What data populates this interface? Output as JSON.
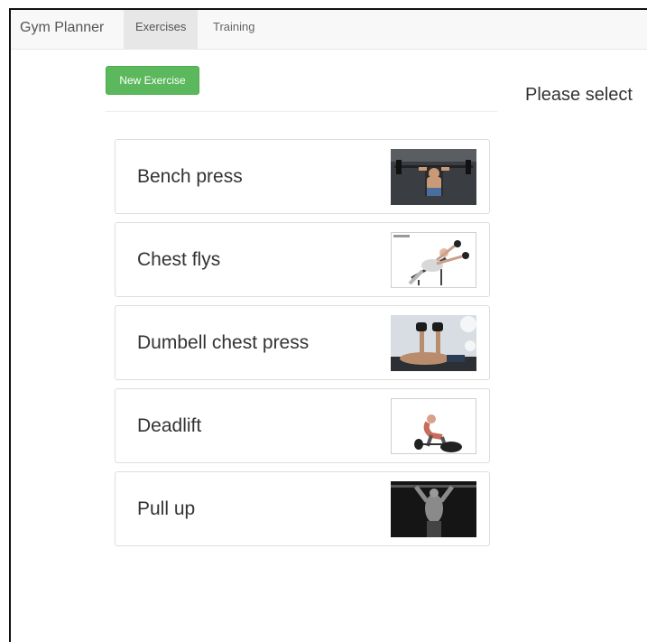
{
  "navbar": {
    "brand": "Gym Planner",
    "tabs": [
      {
        "label": "Exercises",
        "active": true
      },
      {
        "label": "Training",
        "active": false
      }
    ]
  },
  "actions": {
    "new_exercise_label": "New Exercise",
    "button_color": "#5cb85c"
  },
  "detail_panel": {
    "message": "Please select"
  },
  "exercises": [
    {
      "name": "Bench press",
      "thumbnail": "bench-press-photo"
    },
    {
      "name": "Chest flys",
      "thumbnail": "chest-flys-diagram"
    },
    {
      "name": "Dumbell chest press",
      "thumbnail": "dumbell-chest-press-photo"
    },
    {
      "name": "Deadlift",
      "thumbnail": "deadlift-diagram"
    },
    {
      "name": "Pull up",
      "thumbnail": "pull-up-photo"
    }
  ]
}
